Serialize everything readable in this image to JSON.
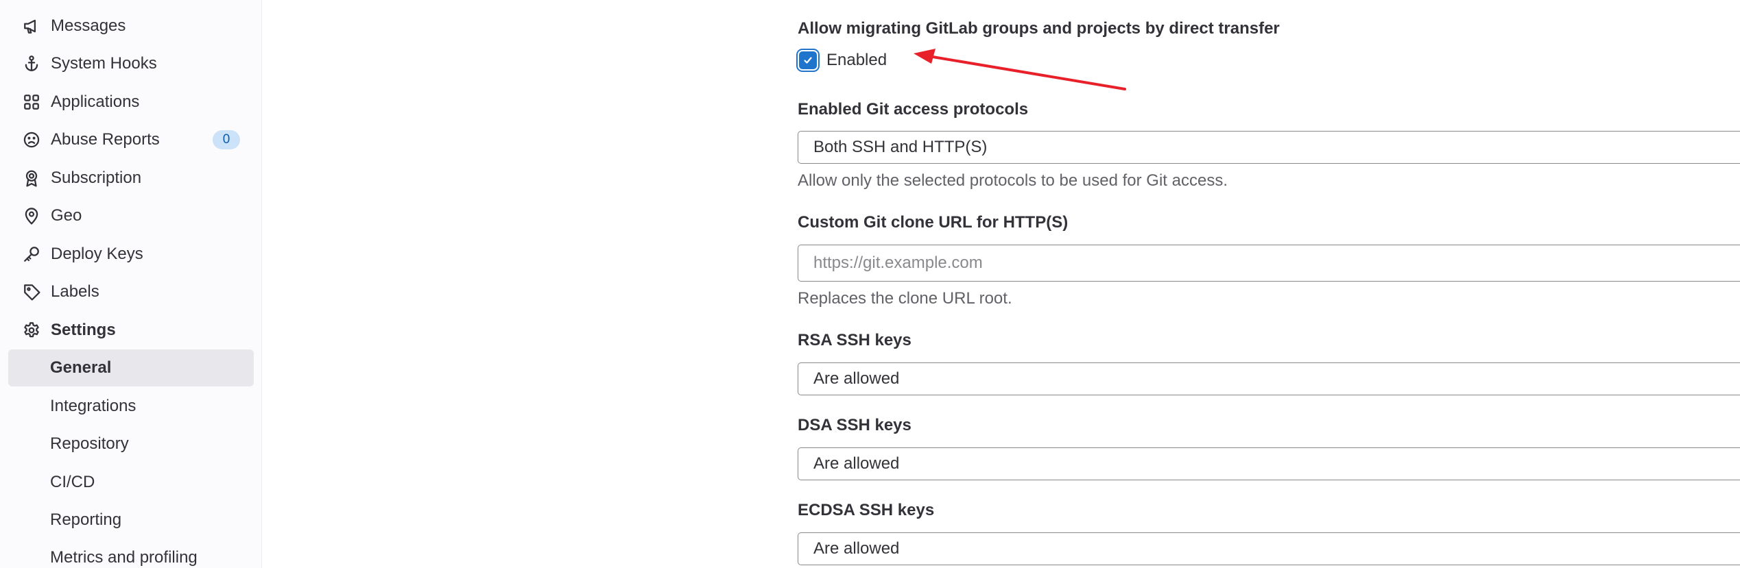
{
  "sidebar": {
    "items": [
      {
        "label": "Messages",
        "icon": "megaphone-icon"
      },
      {
        "label": "System Hooks",
        "icon": "anchor-icon"
      },
      {
        "label": "Applications",
        "icon": "grid-icon"
      },
      {
        "label": "Abuse Reports",
        "icon": "frown-face-icon",
        "badge": "0"
      },
      {
        "label": "Subscription",
        "icon": "ribbon-icon"
      },
      {
        "label": "Geo",
        "icon": "location-pin-icon"
      },
      {
        "label": "Deploy Keys",
        "icon": "key-icon"
      },
      {
        "label": "Labels",
        "icon": "tag-icon"
      },
      {
        "label": "Settings",
        "icon": "gear-icon"
      }
    ],
    "settings_sub": [
      {
        "label": "General",
        "active": true
      },
      {
        "label": "Integrations"
      },
      {
        "label": "Repository"
      },
      {
        "label": "CI/CD"
      },
      {
        "label": "Reporting"
      },
      {
        "label": "Metrics and profiling"
      }
    ]
  },
  "form": {
    "direct_transfer": {
      "label": "Allow migrating GitLab groups and projects by direct transfer",
      "checkbox_label": "Enabled",
      "checked": true
    },
    "git_protocols": {
      "label": "Enabled Git access protocols",
      "value": "Both SSH and HTTP(S)",
      "help": "Allow only the selected protocols to be used for Git access."
    },
    "clone_url": {
      "label": "Custom Git clone URL for HTTP(S)",
      "placeholder": "https://git.example.com",
      "help": "Replaces the clone URL root."
    },
    "rsa_keys": {
      "label": "RSA SSH keys",
      "value": "Are allowed"
    },
    "dsa_keys": {
      "label": "DSA SSH keys",
      "value": "Are allowed"
    },
    "ecdsa_keys": {
      "label": "ECDSA SSH keys",
      "value": "Are allowed"
    }
  },
  "colors": {
    "accent": "#1f75cb",
    "annotation_arrow": "#e8202a",
    "active_item_bg": "#e8e7ec"
  }
}
